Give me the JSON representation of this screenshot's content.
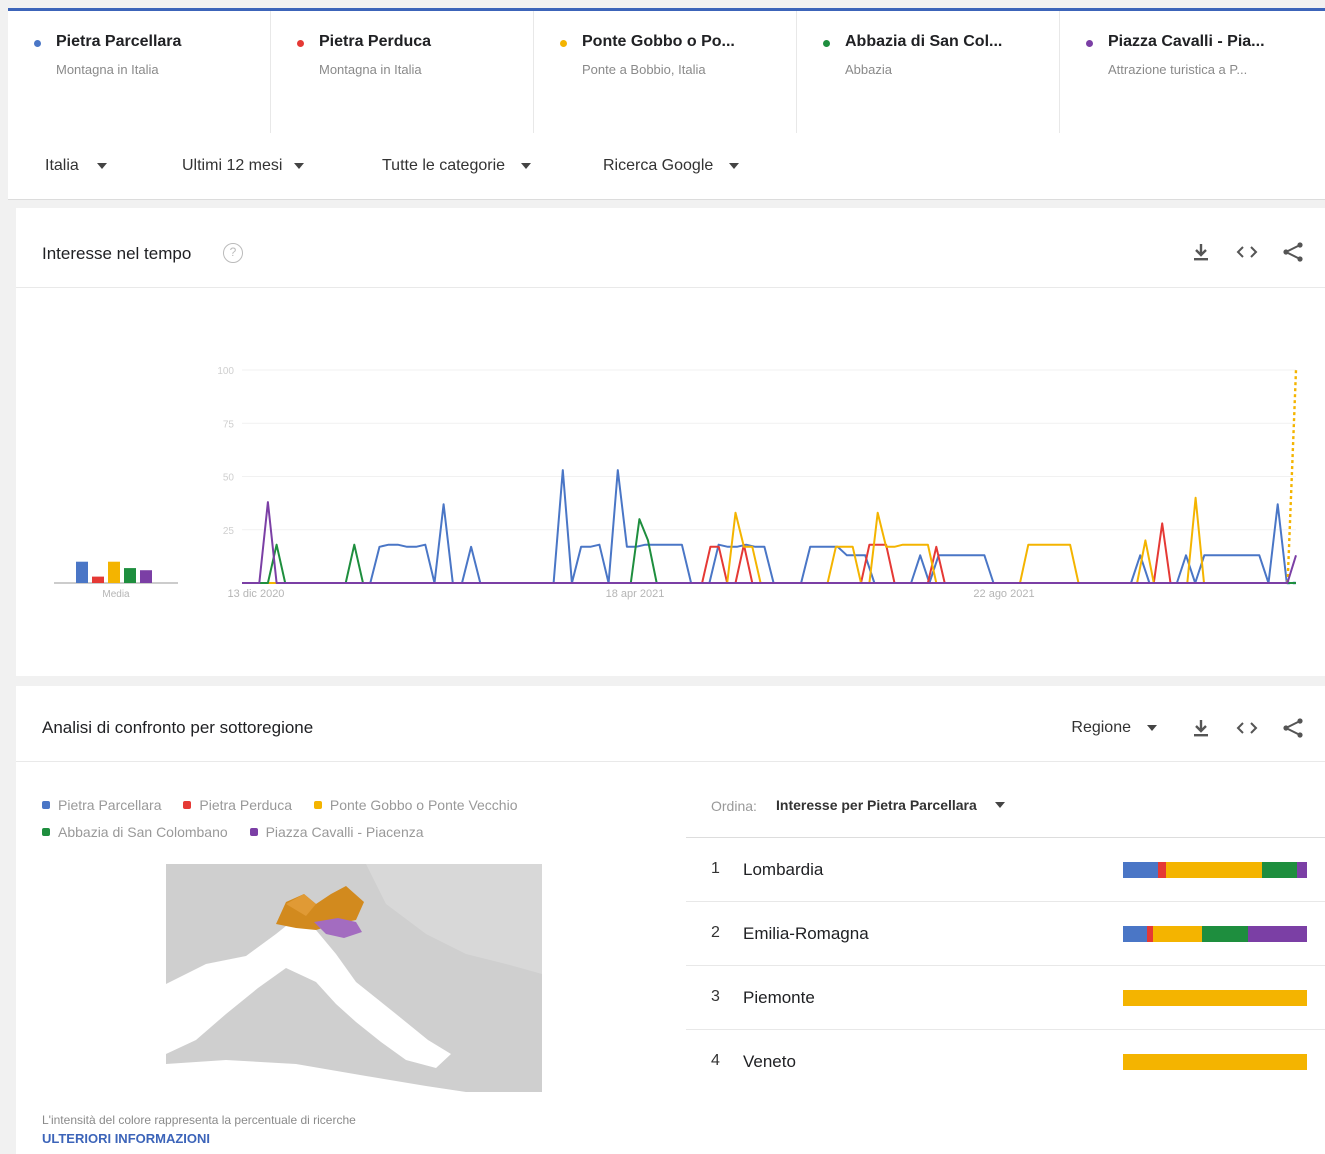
{
  "terms": [
    {
      "name": "Pietra Parcellara",
      "sub": "Montagna in Italia",
      "color": "#4a76c6"
    },
    {
      "name": "Pietra Perduca",
      "sub": "Montagna in Italia",
      "color": "#e53935"
    },
    {
      "name": "Ponte Gobbo o Po...",
      "sub": "Ponte a Bobbio, Italia",
      "color": "#f4b400"
    },
    {
      "name": "Abbazia di San Col...",
      "sub": "Abbazia",
      "color": "#1e8e3e"
    },
    {
      "name": "Piazza Cavalli - Pia...",
      "sub": "Attrazione turistica a P...",
      "color": "#7b3fa5"
    }
  ],
  "filters": {
    "country": "Italia",
    "period": "Ultimi 12 mesi",
    "category": "Tutte le categorie",
    "search_type": "Ricerca Google"
  },
  "interest_over_time": {
    "title": "Interesse nel tempo",
    "help": "?",
    "average_label": "Media"
  },
  "chart_data": {
    "type": "line",
    "x_tick_labels": [
      "13 dic 2020",
      "18 apr 2021",
      "22 ago 2021"
    ],
    "y_tick_labels": [
      "100",
      "75",
      "50",
      "25"
    ],
    "ylim": [
      0,
      100
    ],
    "averages": [
      {
        "name": "Pietra Parcellara",
        "value": 10
      },
      {
        "name": "Pietra Perduca",
        "value": 3
      },
      {
        "name": "Ponte Gobbo o Ponte Vecchio",
        "value": 10
      },
      {
        "name": "Abbazia di San Colombano",
        "value": 7
      },
      {
        "name": "Piazza Cavalli - Piacenza",
        "value": 6
      }
    ],
    "series": [
      {
        "name": "Pietra Parcellara",
        "color": "#4a76c6",
        "values": [
          0,
          0,
          0,
          0,
          0,
          0,
          0,
          0,
          0,
          0,
          0,
          0,
          0,
          0,
          0,
          17,
          18,
          18,
          17,
          17,
          18,
          0,
          37,
          0,
          0,
          17,
          0,
          0,
          0,
          0,
          0,
          0,
          0,
          0,
          0,
          53,
          0,
          17,
          17,
          18,
          0,
          53,
          17,
          17,
          18,
          18,
          18,
          18,
          18,
          0,
          0,
          0,
          18,
          17,
          17,
          18,
          17,
          17,
          0,
          0,
          0,
          0,
          17,
          17,
          17,
          17,
          13,
          13,
          13,
          0,
          0,
          0,
          0,
          0,
          13,
          0,
          13,
          13,
          13,
          13,
          13,
          13,
          0,
          0,
          0,
          0,
          0,
          0,
          0,
          0,
          0,
          0,
          0,
          0,
          0,
          0,
          0,
          0,
          13,
          0,
          0,
          0,
          0,
          13,
          0,
          13,
          13,
          13,
          13,
          13,
          13,
          13,
          0,
          37,
          0,
          0
        ]
      },
      {
        "name": "Pietra Perduca",
        "color": "#e53935",
        "values": [
          0,
          0,
          0,
          0,
          0,
          0,
          0,
          0,
          0,
          0,
          0,
          0,
          0,
          0,
          0,
          0,
          0,
          0,
          0,
          0,
          0,
          0,
          0,
          0,
          0,
          0,
          0,
          0,
          0,
          0,
          0,
          0,
          0,
          0,
          0,
          0,
          0,
          0,
          0,
          0,
          0,
          0,
          0,
          0,
          0,
          0,
          0,
          0,
          0,
          0,
          0,
          0,
          0,
          0,
          0,
          0,
          17,
          17,
          0,
          0,
          18,
          0,
          0,
          0,
          0,
          0,
          0,
          0,
          0,
          0,
          0,
          0,
          0,
          0,
          0,
          18,
          18,
          18,
          0,
          0,
          0,
          0,
          0,
          17,
          0,
          0,
          0,
          0,
          0,
          0,
          0,
          0,
          0,
          0,
          0,
          0,
          0,
          0,
          0,
          0,
          0,
          0,
          0,
          0,
          0,
          0,
          0,
          0,
          0,
          0,
          28,
          0,
          0,
          0,
          0,
          0,
          0,
          0,
          0,
          0,
          0,
          0,
          0,
          0,
          0,
          0,
          0
        ]
      },
      {
        "name": "Ponte Gobbo o Ponte Vecchio",
        "color": "#f4b400",
        "values": [
          0,
          0,
          0,
          0,
          0,
          0,
          0,
          0,
          0,
          0,
          0,
          0,
          0,
          0,
          0,
          0,
          0,
          0,
          0,
          0,
          0,
          0,
          0,
          0,
          0,
          0,
          0,
          0,
          0,
          0,
          0,
          0,
          0,
          0,
          0,
          0,
          0,
          0,
          0,
          0,
          0,
          0,
          0,
          0,
          0,
          0,
          0,
          0,
          0,
          0,
          0,
          0,
          0,
          0,
          0,
          0,
          0,
          0,
          0,
          33,
          17,
          17,
          0,
          0,
          0,
          0,
          0,
          0,
          0,
          0,
          0,
          17,
          17,
          17,
          0,
          0,
          33,
          17,
          17,
          18,
          18,
          18,
          18,
          0,
          0,
          0,
          0,
          0,
          0,
          0,
          0,
          0,
          0,
          0,
          18,
          18,
          18,
          18,
          18,
          18,
          0,
          0,
          0,
          0,
          0,
          0,
          0,
          0,
          20,
          0,
          0,
          0,
          0,
          0,
          40,
          0,
          0,
          0,
          0,
          0,
          0,
          0,
          0,
          0,
          0,
          0,
          100
        ]
      },
      {
        "name": "Abbazia di San Colombano",
        "color": "#1e8e3e",
        "values": [
          0,
          0,
          0,
          0,
          18,
          0,
          0,
          0,
          0,
          0,
          0,
          0,
          0,
          18,
          0,
          0,
          0,
          0,
          0,
          0,
          0,
          0,
          0,
          0,
          0,
          0,
          0,
          0,
          0,
          0,
          0,
          0,
          0,
          0,
          0,
          0,
          0,
          0,
          0,
          0,
          0,
          0,
          0,
          0,
          0,
          0,
          30,
          20,
          0,
          0,
          0,
          0,
          0,
          0,
          0,
          0,
          0,
          0,
          0,
          0,
          0,
          0,
          0,
          0,
          0,
          0,
          0,
          0,
          0,
          0,
          0,
          0,
          0,
          0,
          0,
          0,
          0,
          0,
          0,
          0,
          0,
          0,
          0,
          0,
          0,
          0,
          0,
          0,
          0,
          0,
          0,
          0,
          0,
          0,
          0,
          0,
          0,
          0,
          0,
          0,
          0,
          0,
          0,
          0,
          0,
          0,
          0,
          0,
          0,
          0,
          0,
          0,
          0,
          0,
          0,
          0,
          0,
          0,
          0,
          0,
          0,
          0,
          0
        ]
      },
      {
        "name": "Piazza Cavalli - Piacenza",
        "color": "#7b3fa5",
        "values": [
          0,
          0,
          0,
          38,
          0,
          0,
          0,
          0,
          0,
          0,
          0,
          0,
          0,
          0,
          0,
          0,
          0,
          0,
          0,
          0,
          0,
          0,
          0,
          0,
          0,
          0,
          0,
          0,
          0,
          0,
          0,
          0,
          0,
          0,
          0,
          0,
          0,
          0,
          0,
          0,
          0,
          0,
          0,
          0,
          0,
          0,
          0,
          0,
          0,
          0,
          0,
          0,
          0,
          0,
          0,
          0,
          0,
          0,
          0,
          0,
          0,
          0,
          0,
          0,
          0,
          0,
          0,
          0,
          0,
          0,
          0,
          0,
          0,
          0,
          0,
          0,
          0,
          0,
          0,
          0,
          0,
          0,
          0,
          0,
          0,
          0,
          0,
          0,
          0,
          0,
          0,
          0,
          0,
          0,
          0,
          0,
          0,
          0,
          0,
          0,
          0,
          0,
          0,
          0,
          0,
          0,
          0,
          0,
          0,
          0,
          0,
          0,
          0,
          0,
          0,
          0,
          0,
          0,
          0,
          0,
          0,
          0,
          13
        ]
      }
    ]
  },
  "subregion": {
    "title": "Analisi di confronto per sottoregione",
    "region_label": "Regione",
    "legend": [
      {
        "name": "Pietra Parcellara",
        "color": "#4a76c6"
      },
      {
        "name": "Pietra Perduca",
        "color": "#e53935"
      },
      {
        "name": "Ponte Gobbo o Ponte Vecchio",
        "color": "#f4b400"
      },
      {
        "name": "Abbazia di San Colombano",
        "color": "#1e8e3e"
      },
      {
        "name": "Piazza Cavalli - Piacenza",
        "color": "#7b3fa5"
      }
    ],
    "sort_label": "Ordina:",
    "sort_value": "Interesse per Pietra Parcellara",
    "rows": [
      {
        "rank": "1",
        "name": "Lombardia",
        "shares": [
          18,
          4,
          50,
          18,
          5
        ]
      },
      {
        "rank": "2",
        "name": "Emilia-Romagna",
        "shares": [
          12,
          3,
          25,
          23,
          30
        ]
      },
      {
        "rank": "3",
        "name": "Piemonte",
        "shares": [
          0,
          0,
          100,
          0,
          0
        ]
      },
      {
        "rank": "4",
        "name": "Veneto",
        "shares": [
          0,
          0,
          100,
          0,
          0
        ]
      }
    ],
    "footnote": "L'intensità del colore rappresenta la percentuale di ricerche",
    "more_link": "ULTERIORI INFORMAZIONI"
  }
}
